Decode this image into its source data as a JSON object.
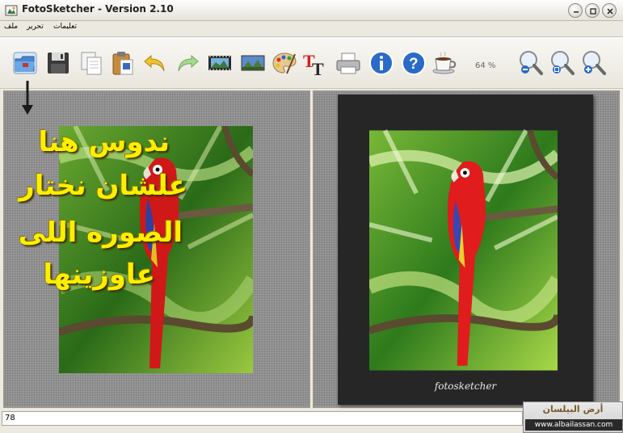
{
  "window": {
    "title": "FotoSketcher - Version 2.10"
  },
  "menu": {
    "items": [
      "ملف",
      "تحرير",
      "تعليمات"
    ]
  },
  "toolbar": {
    "zoom_level": "64 %",
    "buttons": [
      "open-folder-icon",
      "save-icon",
      "copy-icon",
      "paste-icon",
      "undo-icon",
      "redo-icon",
      "film-icon",
      "landscape-icon",
      "palette-icon",
      "text-icon",
      "printer-icon",
      "info-icon",
      "help-icon",
      "coffee-icon",
      "zoom-out-icon",
      "zoom-fit-icon",
      "zoom-in-icon"
    ]
  },
  "overlay": {
    "lines": [
      "ندوس هنا",
      "علشان نختار",
      "الصوره اللى",
      "عاوزينها"
    ],
    "color": "#ffee00"
  },
  "right_pane": {
    "signature": "fotosketcher"
  },
  "status": {
    "text": "78"
  },
  "watermark": {
    "arabic": "أرض البيلسان",
    "url": "www.albailassan.com"
  },
  "colors": {
    "pane_bg": "#909090",
    "frame_bg": "#262626",
    "accent": "#1e5fb4"
  }
}
